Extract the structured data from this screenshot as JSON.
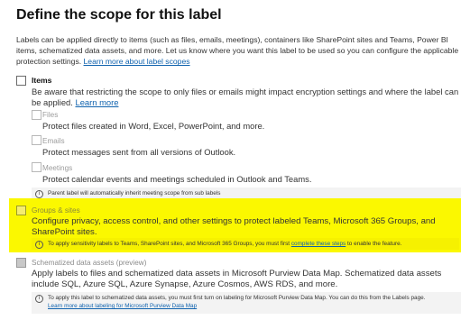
{
  "title": "Define the scope for this label",
  "intro": {
    "text": "Labels can be applied directly to items (such as files, emails, meetings), containers like SharePoint sites and Teams, Power BI items, schematized data assets, and more. Let us know where you want this label to be used so you can configure the applicable protection settings.",
    "link": "Learn more about label scopes"
  },
  "items": {
    "label": "Items",
    "description": "Be aware that restricting the scope to only files or emails might impact encryption settings and where the label can be applied.",
    "link": "Learn more",
    "files": {
      "label": "Files",
      "description": "Protect files created in Word, Excel, PowerPoint, and more."
    },
    "emails": {
      "label": "Emails",
      "description": "Protect messages sent from all versions of Outlook."
    },
    "meetings": {
      "label": "Meetings",
      "description": "Protect calendar events and meetings scheduled in Outlook and Teams."
    },
    "info": "Parent label will automatically inherit meeting scope from sub labels"
  },
  "groups": {
    "label": "Groups & sites",
    "description": "Configure privacy, access control, and other settings to protect labeled Teams, Microsoft 365 Groups, and SharePoint sites.",
    "info_before": "To apply sensitivity labels to Teams, SharePoint sites, and Microsoft 365 Groups, you must first",
    "info_link": "complete these steps",
    "info_after": "to enable the feature.",
    "highlight_color": "#fbf800"
  },
  "schematized": {
    "label": "Schematized data assets (preview)",
    "description": "Apply labels to files and schematized data assets in Microsoft Purview Data Map. Schematized data assets include SQL, Azure SQL, Azure Synapse, Azure Cosmos, AWS RDS, and more.",
    "info": "To apply this label to schematized data assets, you must first turn on labeling for Microsoft Purview Data Map. You can do this from the Labels page.",
    "info_link": "Learn more about labeling for Microsoft Purview Data Map"
  },
  "colors": {
    "link": "#0f62ae",
    "info_bg": "#f3f3f3"
  }
}
